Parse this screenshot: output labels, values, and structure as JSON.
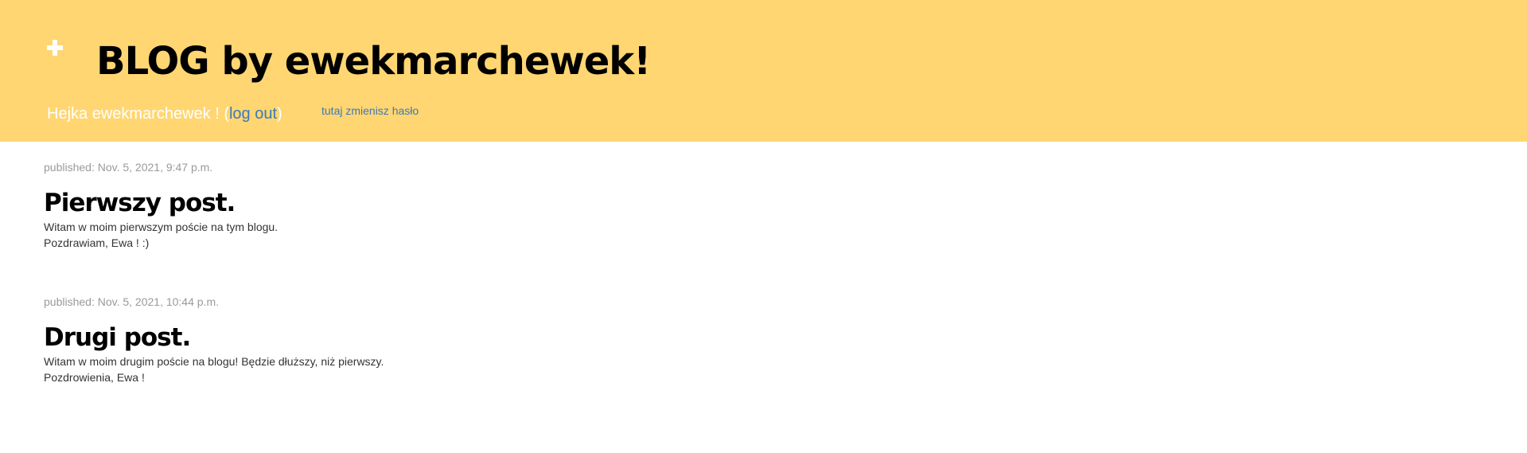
{
  "header": {
    "background_color": "#ffd672",
    "add_icon": "plus-icon",
    "title": "BLOG by ewekmarchewek!",
    "greeting": "Hejka ewekmarchewek !",
    "paren_open": "(",
    "logout_label": "log out",
    "paren_close": ")",
    "change_password_label": "tutaj zmienisz hasło",
    "link_color": "#3c79b8"
  },
  "posts": [
    {
      "published": "published: Nov. 5, 2021, 9:47 p.m.",
      "title": "Pierwszy post.",
      "body": [
        "Witam w moim pierwszym poście na tym blogu.",
        "Pozdrawiam, Ewa ! :)"
      ]
    },
    {
      "published": "published: Nov. 5, 2021, 10:44 p.m.",
      "title": "Drugi post.",
      "body": [
        "Witam w moim drugim poście na blogu! Będzie dłuższy, niż pierwszy.",
        "Pozdrowienia, Ewa !"
      ]
    }
  ]
}
